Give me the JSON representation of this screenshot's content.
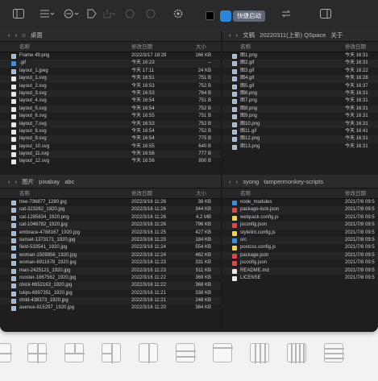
{
  "toolbar": {
    "quick_launch": "快捷启动"
  },
  "panes": {
    "top_left": {
      "path": [
        "桌面"
      ],
      "columns": {
        "name": "名称",
        "date": "修改日期",
        "size": "大小"
      },
      "rows": [
        {
          "name": "Frame 49.png",
          "date": "2022/3/17 18:29",
          "size": "166 KB",
          "kind": "img"
        },
        {
          "name": ".gif",
          "date": "今天 16:23",
          "size": "--",
          "kind": "folder"
        },
        {
          "name": "layout_1.jpeg",
          "date": "今天 17:11",
          "size": "24 KB",
          "kind": "img"
        },
        {
          "name": "layout_1.svg",
          "date": "今天 16:51",
          "size": "751 B",
          "kind": "doc"
        },
        {
          "name": "layout_2.svg",
          "date": "今天 16:53",
          "size": "752 B",
          "kind": "doc"
        },
        {
          "name": "layout_3.svg",
          "date": "今天 16:53",
          "size": "764 B",
          "kind": "doc"
        },
        {
          "name": "layout_4.svg",
          "date": "今天 16:54",
          "size": "751 B",
          "kind": "doc"
        },
        {
          "name": "layout_5.svg",
          "date": "今天 16:54",
          "size": "752 B",
          "kind": "doc"
        },
        {
          "name": "layout_6.svg",
          "date": "今天 16:55",
          "size": "751 B",
          "kind": "doc"
        },
        {
          "name": "layout_7.svg",
          "date": "今天 16:53",
          "size": "752 B",
          "kind": "doc"
        },
        {
          "name": "layout_8.svg",
          "date": "今天 16:54",
          "size": "752 B",
          "kind": "doc"
        },
        {
          "name": "layout_9.svg",
          "date": "今天 16:54",
          "size": "775 B",
          "kind": "doc"
        },
        {
          "name": "layout_10.svg",
          "date": "今天 16:55",
          "size": "640 B",
          "kind": "doc"
        },
        {
          "name": "layout_11.svg",
          "date": "今天 16:56",
          "size": "777 B",
          "kind": "doc"
        },
        {
          "name": "layout_12.svg",
          "date": "今天 16:56",
          "size": "800 B",
          "kind": "doc"
        }
      ]
    },
    "top_right": {
      "path": [
        "文稿",
        "20220311(上新) QSpace",
        "关于"
      ],
      "columns": {
        "name": "名称",
        "date": "修改日期"
      },
      "rows": [
        {
          "name": "图1.png",
          "date": "今天 16:31",
          "kind": "img"
        },
        {
          "name": "图2.gif",
          "date": "今天 16:31",
          "kind": "img"
        },
        {
          "name": "图3.gif",
          "date": "今天 16:22",
          "kind": "img"
        },
        {
          "name": "图4.gif",
          "date": "今天 16:28",
          "kind": "img"
        },
        {
          "name": "图5.gif",
          "date": "今天 16:37",
          "kind": "img"
        },
        {
          "name": "图6.png",
          "date": "今天 16:31",
          "kind": "img"
        },
        {
          "name": "图7.png",
          "date": "今天 16:31",
          "kind": "img"
        },
        {
          "name": "图8.png",
          "date": "今天 16:31",
          "kind": "img"
        },
        {
          "name": "图9.png",
          "date": "今天 16:31",
          "kind": "img"
        },
        {
          "name": "图10.png",
          "date": "今天 16:31",
          "kind": "img"
        },
        {
          "name": "图11.gif",
          "date": "今天 16:41",
          "kind": "img"
        },
        {
          "name": "图12.png",
          "date": "今天 16:31",
          "kind": "img"
        },
        {
          "name": "图13.png",
          "date": "今天 16:31",
          "kind": "img"
        }
      ]
    },
    "bottom_left": {
      "path": [
        "图片",
        "pixabay",
        "abc"
      ],
      "columns": {
        "name": "名称",
        "date": "修改日期",
        "size": "大小"
      },
      "rows": [
        {
          "name": "tree-736877_1280.jpg",
          "date": "2022/3/16 11:26",
          "size": "38 KB",
          "kind": "img"
        },
        {
          "name": "cat-323262_1920.jpg",
          "date": "2022/3/16 11:26",
          "size": "344 KB",
          "kind": "img"
        },
        {
          "name": "cat-1285634_1920.png",
          "date": "2022/3/16 11:26",
          "size": "4.2 MB",
          "kind": "img"
        },
        {
          "name": "cat-1046782_1920.jpg",
          "date": "2022/3/16 11:26",
          "size": "796 KB",
          "kind": "img"
        },
        {
          "name": "embrace-4788167_1920.jpg",
          "date": "2022/3/16 11:25",
          "size": "427 KB",
          "kind": "img"
        },
        {
          "name": "sunset-1373171_1920.jpg",
          "date": "2022/3/16 11:25",
          "size": "184 KB",
          "kind": "img"
        },
        {
          "name": "field-533541_1920.jpg",
          "date": "2022/3/16 11:24",
          "size": "554 KB",
          "kind": "img"
        },
        {
          "name": "woman-1509956_1920.jpg",
          "date": "2022/3/16 11:24",
          "size": "462 KB",
          "kind": "img"
        },
        {
          "name": "woman-6911678_1920.jpg",
          "date": "2022/3/16 11:23",
          "size": "331 KB",
          "kind": "img"
        },
        {
          "name": "man-2425121_1920.jpg",
          "date": "2022/3/16 11:23",
          "size": "511 KB",
          "kind": "img"
        },
        {
          "name": "rooster-1867562_1920.jpg",
          "date": "2022/3/16 11:22",
          "size": "369 KB",
          "kind": "img"
        },
        {
          "name": "chick-6652163_1920.jpg",
          "date": "2022/3/16 11:22",
          "size": "368 KB",
          "kind": "img"
        },
        {
          "name": "tulips-6897351_1920.jpg",
          "date": "2022/3/16 11:21",
          "size": "338 KB",
          "kind": "img"
        },
        {
          "name": "child-438373_1920.jpg",
          "date": "2022/3/16 11:21",
          "size": "248 KB",
          "kind": "img"
        },
        {
          "name": "avenue-815297_1920.jpg",
          "date": "2022/3/16 11:20",
          "size": "384 KB",
          "kind": "img"
        }
      ]
    },
    "bottom_right": {
      "path": [
        "syong",
        "tampermonkey-scripts"
      ],
      "columns": {
        "name": "名称",
        "date": "修改日期"
      },
      "rows": [
        {
          "name": "node_modules",
          "date": "2021/7/8 09:5",
          "kind": "folder"
        },
        {
          "name": "package-lock.json",
          "date": "2021/7/8 09:5",
          "kind": "json"
        },
        {
          "name": "webpack.config.js",
          "date": "2021/7/8 09:5",
          "kind": "js"
        },
        {
          "name": "jsconfig.json",
          "date": "2021/7/8 09:5",
          "kind": "json"
        },
        {
          "name": "stylelint.config.js",
          "date": "2021/7/8 09:5",
          "kind": "js"
        },
        {
          "name": "src",
          "date": "2021/7/8 09:5",
          "kind": "folder"
        },
        {
          "name": "postcss.config.js",
          "date": "2021/7/8 09:5",
          "kind": "js"
        },
        {
          "name": "package.json",
          "date": "2021/7/8 09:5",
          "kind": "json"
        },
        {
          "name": "jsconfig.json",
          "date": "2021/7/8 09:5",
          "kind": "json"
        },
        {
          "name": "README.md",
          "date": "2021/7/8 09:5",
          "kind": "doc"
        },
        {
          "name": "LICENSE",
          "date": "2021/7/8 09:5",
          "kind": "doc"
        }
      ]
    }
  },
  "layout_icons": [
    "split-horizontal-icon",
    "quad-grid-icon",
    "top-bottom-split-icon",
    "vertical-split-icon",
    "three-columns-icon",
    "center-band-icon",
    "box-icon",
    "four-columns-icon",
    "five-columns-icon",
    "four-rows-icon"
  ]
}
